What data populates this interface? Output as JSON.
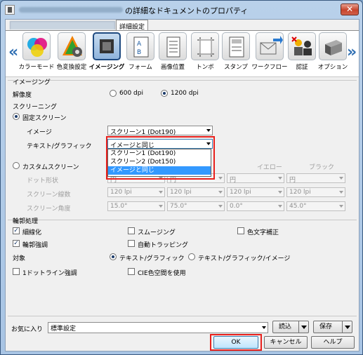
{
  "window": {
    "title": "の詳細なドキュメントのプロパティ",
    "close_glyph": "✕"
  },
  "tabs": {
    "detail": "詳細設定"
  },
  "toolbar": {
    "items": [
      {
        "label": "カラーモード",
        "icon": "color-mode-icon"
      },
      {
        "label": "色変換設定",
        "icon": "color-conversion-icon"
      },
      {
        "label": "イメージング",
        "icon": "imaging-icon"
      },
      {
        "label": "フォーム",
        "icon": "form-icon"
      },
      {
        "label": "画像位置",
        "icon": "image-position-icon"
      },
      {
        "label": "トンボ",
        "icon": "crop-marks-icon"
      },
      {
        "label": "スタンプ",
        "icon": "stamp-icon"
      },
      {
        "label": "ワークフロー",
        "icon": "workflow-icon"
      },
      {
        "label": "認証",
        "icon": "authentication-icon"
      },
      {
        "label": "オプション",
        "icon": "option-icon"
      }
    ],
    "left_arrow": "«",
    "right_arrow": "»"
  },
  "imaging": {
    "section_title": "イメージング",
    "resolution_label": "解像度",
    "dpi_600": "600 dpi",
    "dpi_1200": "1200 dpi",
    "screening_title": "スクリーニング",
    "fixed_screen": "固定スクリーン",
    "image_label": "イメージ",
    "image_value": "スクリーン1 (Dot190)",
    "text_graphic_label": "テキスト/グラフィック",
    "text_graphic_value": "イメージと同じ",
    "dropdown_options": [
      "スクリーン1 (Dot190)",
      "スクリーン2 (Dot150)",
      "イメージと同じ"
    ],
    "custom_screen": "カスタムスクリーン",
    "col_yellow": "イエロー",
    "col_black": "ブラック",
    "dot_shape_label": "ドット形状",
    "screen_lines_label": "スクリーン線数",
    "screen_angle_label": "スクリーン角度",
    "dot_shape_values": [
      "円",
      "円",
      "円",
      "円"
    ],
    "screen_lines_values": [
      "120 lpi",
      "120 lpi",
      "120 lpi",
      "120 lpi"
    ],
    "screen_angle_values": [
      "15.0°",
      "75.0°",
      "0.0°",
      "45.0°"
    ]
  },
  "edge": {
    "section_title": "輪郭処理",
    "thin_line": "細線化",
    "smoothing": "スムージング",
    "color_char": "色文字補正",
    "edge_enhance": "輪郭強調",
    "auto_trap": "自動トラッピング",
    "target_label": "対象",
    "target_text": "テキスト/グラフィック",
    "target_text_image": "テキスト/グラフィック/イメージ",
    "one_dot_line": "1ドットライン強調",
    "cie": "CIE色空間を使用"
  },
  "footer": {
    "favorites_label": "お気に入り",
    "favorites_value": "標準設定",
    "load": "読込",
    "save": "保存",
    "ok": "OK",
    "cancel": "キャンセル",
    "help": "ヘルプ"
  }
}
